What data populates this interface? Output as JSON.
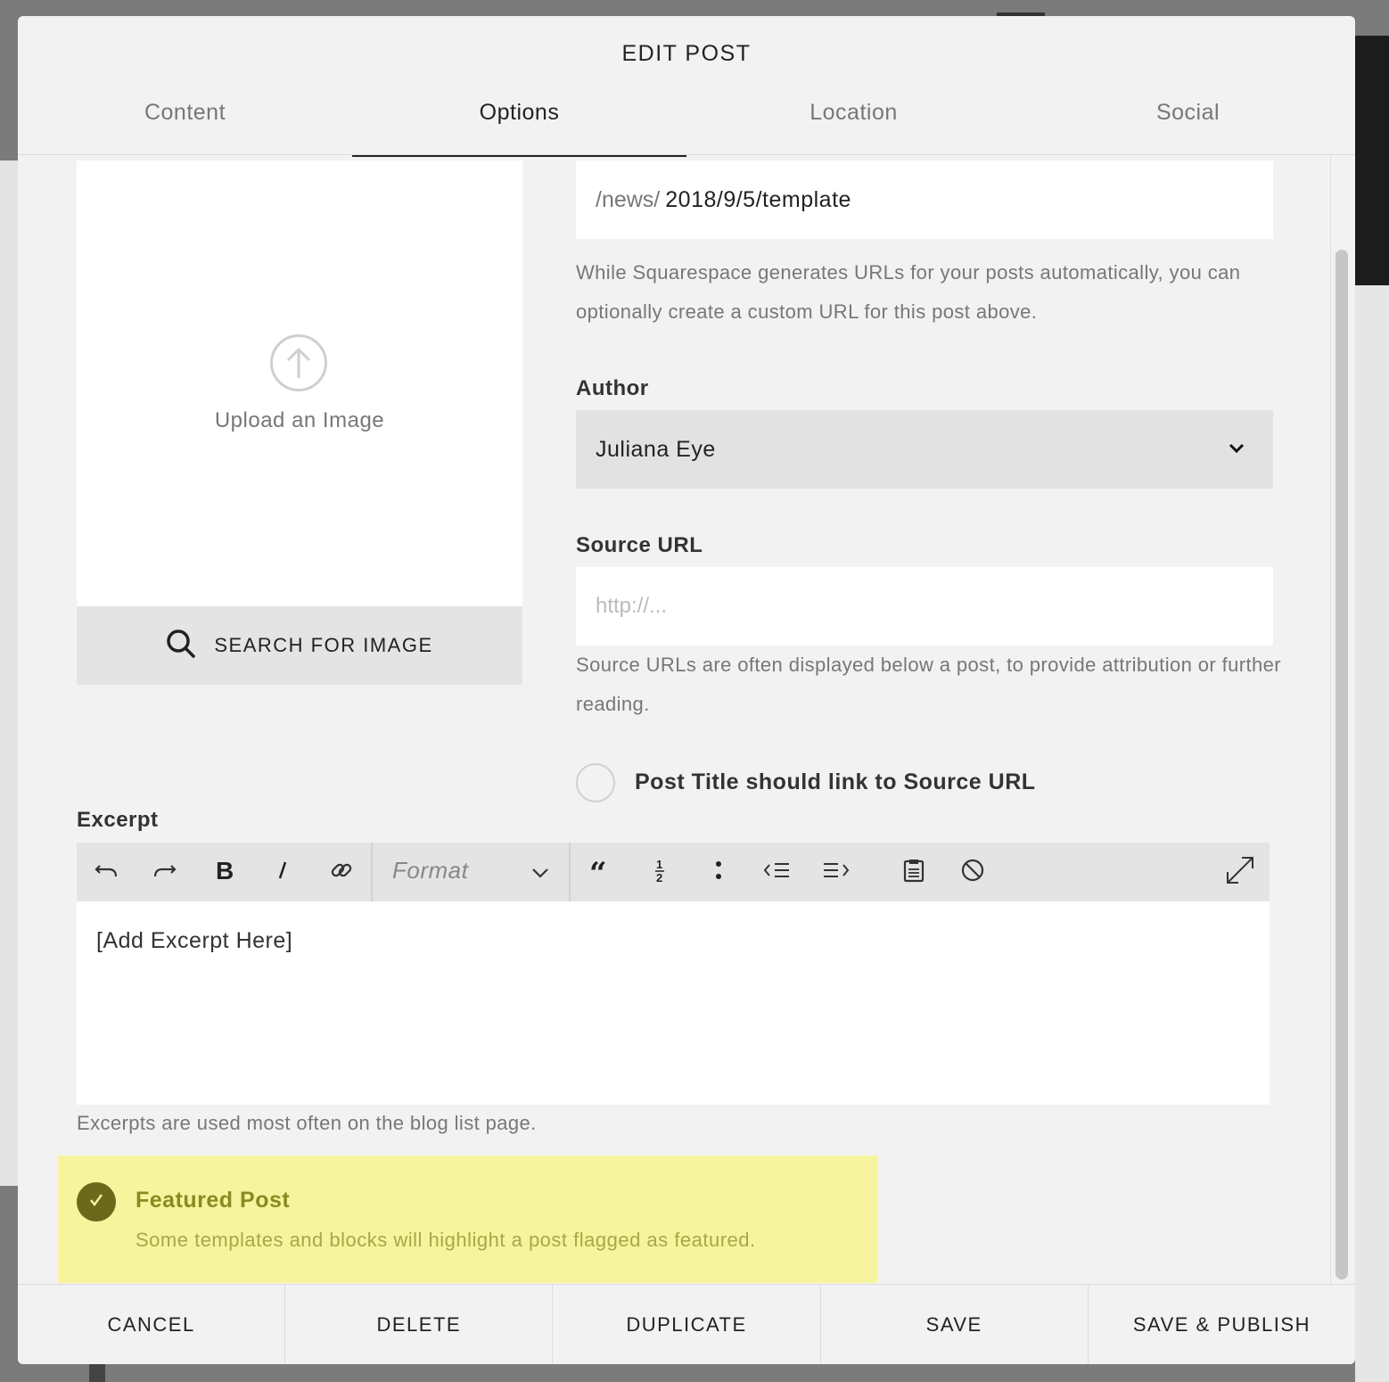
{
  "modal": {
    "title": "EDIT POST",
    "tabs": [
      {
        "label": "Content",
        "active": false
      },
      {
        "label": "Options",
        "active": true
      },
      {
        "label": "Location",
        "active": false
      },
      {
        "label": "Social",
        "active": false
      }
    ]
  },
  "image": {
    "upload_label": "Upload an Image",
    "search_label": "SEARCH FOR IMAGE"
  },
  "url": {
    "prefix": "/news/",
    "slug": "2018/9/5/template",
    "help": "While Squarespace generates URLs for your posts automatically, you can optionally create a custom URL for this post above."
  },
  "author": {
    "label": "Author",
    "value": "Juliana Eye"
  },
  "source_url": {
    "label": "Source URL",
    "placeholder": "http://...",
    "value": "",
    "help": "Source URLs are often displayed below a post, to provide attribution or further reading."
  },
  "title_link": {
    "label": "Post Title should link to Source URL",
    "checked": false
  },
  "excerpt": {
    "label": "Excerpt",
    "format_label": "Format",
    "text": "[Add Excerpt Here]",
    "help": "Excerpts are used most often on the blog list page."
  },
  "featured": {
    "title": "Featured Post",
    "description": "Some templates and blocks will highlight a post flagged as featured.",
    "checked": true,
    "colors": {
      "background": "#f6f49c",
      "check": "#6b6a1c",
      "title": "#8a8a22"
    }
  },
  "footer": {
    "cancel": "CANCEL",
    "delete": "DELETE",
    "duplicate": "DUPLICATE",
    "save": "SAVE",
    "save_publish": "SAVE & PUBLISH"
  },
  "icons": [
    "upload-icon",
    "search-icon",
    "chevron-down-icon",
    "undo-icon",
    "redo-icon",
    "bold-icon",
    "italic-icon",
    "link-icon",
    "quote-icon",
    "ordered-list-icon",
    "bullet-list-icon",
    "outdent-icon",
    "indent-icon",
    "paste-icon",
    "clear-format-icon",
    "expand-icon",
    "checkmark-icon"
  ]
}
